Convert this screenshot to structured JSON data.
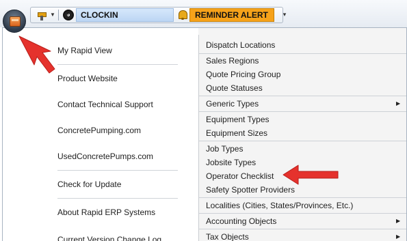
{
  "toolbar": {
    "clockin_label": "CLOCKIN",
    "reminder_label": "REMINDER ALERT"
  },
  "menu": {
    "left_items": [
      "My Rapid View",
      "Product Website",
      "Contact Technical Support",
      "ConcretePumping.com",
      "UsedConcretePumps.com",
      "Check for Update",
      "About Rapid ERP Systems",
      "Current Version Change Log"
    ],
    "right_items": [
      "Dispatch Locations",
      "Sales Regions",
      "Quote Pricing Group",
      "Quote Statuses",
      "Generic Types",
      "Equipment Types",
      "Equipment Sizes",
      "Job Types",
      "Jobsite Types",
      "Operator Checklist",
      "Safety Spotter Providers",
      "Localities (Cities, States/Provinces, Etc.)",
      "Accounting Objects",
      "Tax Objects"
    ]
  },
  "colors": {
    "reminder_bg": "#f6a21a",
    "clockin_bg": "#c4dcf6",
    "callout_red": "#e5322d"
  },
  "icons": [
    "application-menu-icon",
    "drill-icon",
    "clock-icon",
    "bell-icon"
  ]
}
